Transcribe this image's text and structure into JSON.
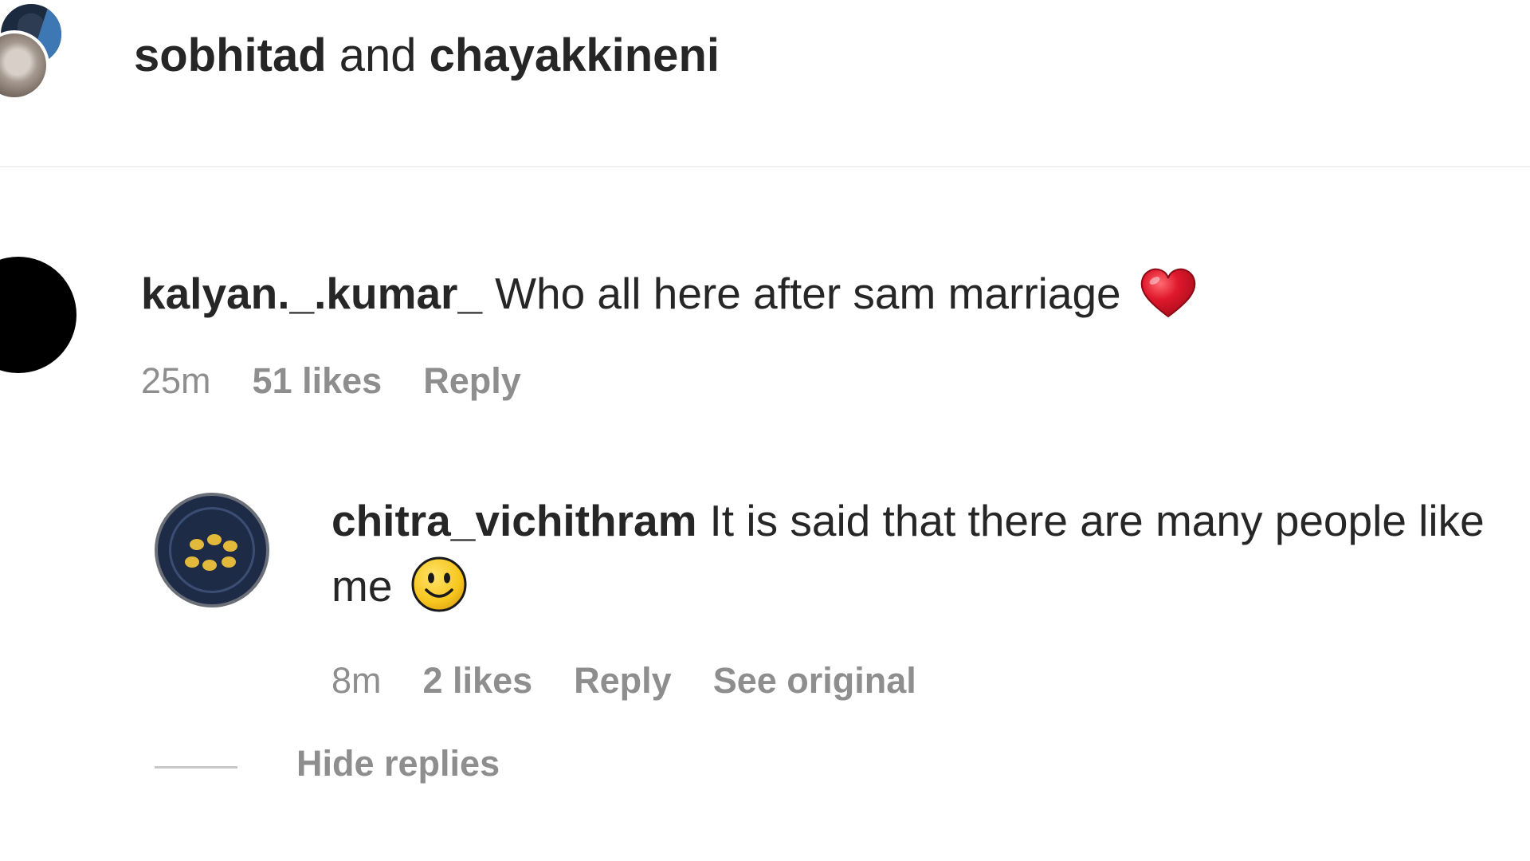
{
  "header": {
    "user1": "sobhitad",
    "connector": " and ",
    "user2": "chayakkineni"
  },
  "comments": [
    {
      "username": "kalyan._.kumar_",
      "text": "Who all here after sam marriage",
      "emoji": "red-heart",
      "time": "25m",
      "likes": "51 likes",
      "reply_label": "Reply",
      "replies": [
        {
          "username": "chitra_vichithram",
          "text": "It is said that there are many people like me",
          "emoji": "slightly-smiling-face",
          "time": "8m",
          "likes": "2 likes",
          "reply_label": "Reply",
          "see_original_label": "See original"
        }
      ],
      "hide_replies_label": "Hide replies"
    }
  ],
  "colors": {
    "text": "#262626",
    "meta": "#8e8e8e",
    "divider": "#efefef",
    "heart": "#e0182d",
    "smile": "#f7c61e"
  }
}
